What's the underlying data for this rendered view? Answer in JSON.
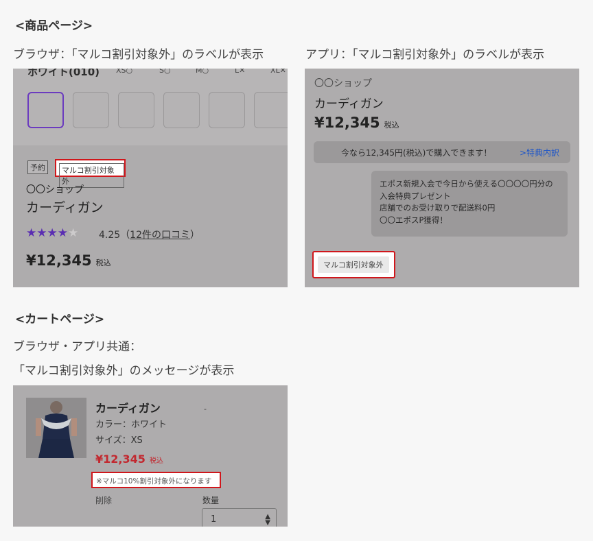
{
  "sections": {
    "product_heading": "<商品ページ>",
    "cart_heading": "<カートページ>"
  },
  "captions": {
    "browser": "ブラウザ：「マルコ割引対象外」のラベルが表示",
    "app": "アプリ：「マルコ割引対象外」のラベルが表示",
    "cart_line1": "ブラウザ・アプリ共通：",
    "cart_line2": "「マルコ割引対象外」のメッセージが表示"
  },
  "browser_shot": {
    "color_name": "ホワイト(010)",
    "sizes": [
      "XS",
      "S",
      "M",
      "L",
      "XL"
    ],
    "tag_reserve": "予約",
    "tag_marco": "マルコ割引対象外",
    "shop": "〇〇ショップ",
    "product_name": "カーディガン",
    "rating_value": "4.25",
    "rating_stars": 4,
    "review_link": "12件の口コミ",
    "price": "¥12,345",
    "tax_label": "税込"
  },
  "app_shot": {
    "shop": "〇〇ショップ",
    "product_name": "カーディガン",
    "price": "¥12,345",
    "tax_label": "税込",
    "promo_text": "今なら12,345円(税込)で購入できます！",
    "promo_link": ">特典内訳",
    "benefit_lines": [
      "エポス新規入会で今日から使える〇〇〇〇円分の",
      "入会特典プレゼント",
      "店舗でのお受け取りで配送料0円",
      "〇〇エポスP獲得！"
    ],
    "tag_marco": "マルコ割引対象外"
  },
  "cart_shot": {
    "product_name": "カーディガン",
    "dash": "-",
    "color": "カラー：ホワイト",
    "size": "サイズ：XS",
    "price": "¥12,345",
    "tax_label": "税込",
    "note": "※マルコ10%割引対象外になります",
    "delete_label": "削除",
    "qty_label": "数量",
    "qty_value": "1"
  },
  "colors": {
    "highlight": "#d0161b",
    "star": "#5a2db2",
    "selected_swatch": "#6b3bbf",
    "cart_price": "#c2282f",
    "link": "#1d55c8",
    "overlay": "#aeacad"
  }
}
